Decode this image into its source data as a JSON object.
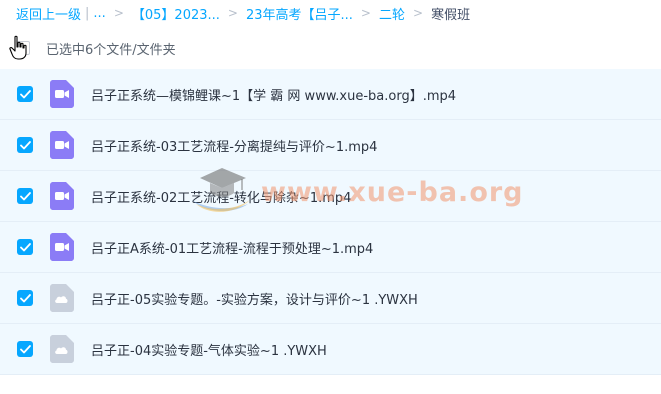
{
  "breadcrumb": {
    "back_label": "返回上一级",
    "separator": "|",
    "ellipsis": "...",
    "items": [
      "【05】2023...",
      "23年高考【吕子...",
      "二轮"
    ],
    "current": "寒假班"
  },
  "selection": {
    "status_text": "已选中6个文件/文件夹"
  },
  "files": [
    {
      "name": "吕子正系统—模锦鲤课~1【学 霸 网 www.xue-ba.org】.mp4",
      "type": "video",
      "checked": true
    },
    {
      "name": "吕子正系统-03工艺流程-分离提纯与评价~1.mp4",
      "type": "video",
      "checked": true
    },
    {
      "name": "吕子正系统-02工艺流程-转化与除杂~1.mp4",
      "type": "video",
      "checked": true
    },
    {
      "name": "吕子正A系统-01工艺流程-流程于预处理~1.mp4",
      "type": "video",
      "checked": true
    },
    {
      "name": "吕子正-05实验专题。-实验方案，设计与评价~1 .YWXH",
      "type": "unknown",
      "checked": true
    },
    {
      "name": "吕子正-04实验专题-气体实验~1 .YWXH",
      "type": "unknown",
      "checked": true
    }
  ],
  "watermark": {
    "text": "www.xue-ba.org"
  },
  "colors": {
    "accent": "#06a7ff",
    "row_bg": "#f0f9ff",
    "video_icon": "#8b7cf6",
    "unknown_icon": "#c8d0dc"
  }
}
